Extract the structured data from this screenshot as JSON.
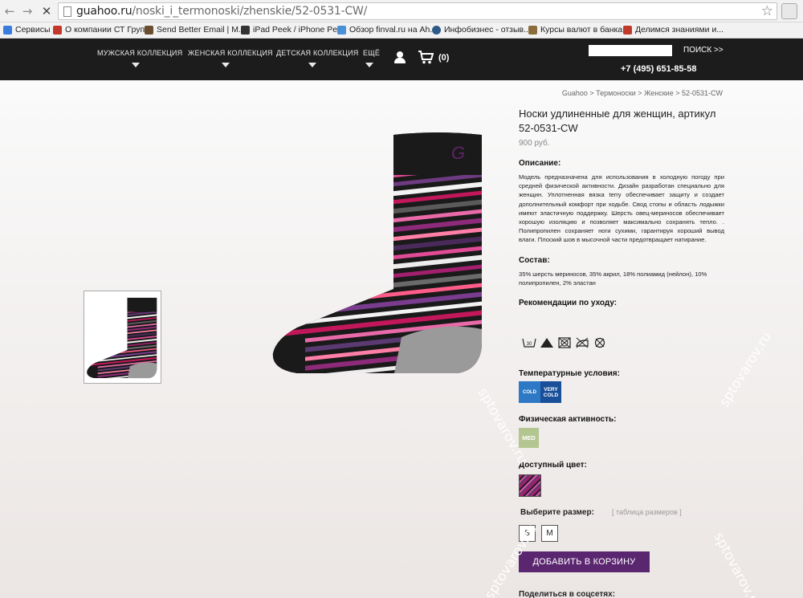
{
  "browser": {
    "url_host": "guahoo.ru",
    "url_path": "/noski_i_termonoski/zhenskie/52-0531-CW/"
  },
  "bookmarks": [
    {
      "label": "Сервисы",
      "color": "#3b7ddd"
    },
    {
      "label": "О компании СТ Групп",
      "color": "#c0392b"
    },
    {
      "label": "Send Better Email | M...",
      "color": "#6b4e2e"
    },
    {
      "label": "iPad Peek / iPhone Pe...",
      "color": "#333333"
    },
    {
      "label": "Обзор finval.ru на Ah...",
      "color": "#4a90d9"
    },
    {
      "label": "Инфобизнес - отзыв...",
      "color": "#2e5a88"
    },
    {
      "label": "Курсы валют в банка...",
      "color": "#8a6d3b"
    },
    {
      "label": "Делимся знаниями и...",
      "color": "#c0392b"
    }
  ],
  "nav": {
    "men": "МУЖСКАЯ КОЛЛЕКЦИЯ",
    "women": "ЖЕНСКАЯ КОЛЛЕКЦИЯ",
    "kids": "ДЕТСКАЯ КОЛЛЕКЦИЯ",
    "more": "ЕЩЁ",
    "cart_count": "(0)",
    "search": "ПОИСК >>",
    "phone": "+7 (495) 651-85-58"
  },
  "breadcrumb": "Guahoo > Термоноски > Женские > 52-0531-CW",
  "product": {
    "title": "Носки удлиненные для женщин, артикул 52-0531-CW",
    "price": "900 руб.",
    "description_heading": "Описание:",
    "description": "Модель предназначена для использования в холодную погоду при средней физической активности. Дизайн разработан специально для женщин. Уплотненная вязка terry обеспечивает защиту и создает дополнительный комфорт при ходьбе. Свод стопы и область лодыжки имеют эластичную поддержку. Шерсть овец-мериносов обеспечивает хорошую изоляцию и позволяет максимально сохранять тепло. . Полипропилен сохраняет ноги сухими, гарантируя хороший вывод влаги. Плоский шов в мысочной части предотвращает натирание.",
    "composition_heading": "Состав:",
    "composition": "35% шерсть мериносов, 35% акрил, 18% полиамид (нейлон), 10% полипропилен, 2% эластан",
    "care_heading": "Рекомендации по уходу:",
    "care_wash_temp": "30",
    "temp_heading": "Температурные условия:",
    "temp_badge_cold": "COLD",
    "temp_badge_vcold": "VERY COLD",
    "activity_heading": "Физическая активность:",
    "activity_badge": "MED",
    "color_heading": "Доступный цвет:",
    "size_heading": "Выберите размер:",
    "size_table": "[ таблица размеров ]",
    "sizes": [
      "S",
      "M"
    ],
    "add_to_cart": "ДОБАВИТЬ В КОРЗИНУ",
    "share_heading": "Поделиться в соцсетях:"
  },
  "watermark": "sptovarov.ru",
  "colors": {
    "header_bg": "#1c1c1c",
    "cart_button": "#5b2670",
    "sock_black": "#1a1a1a",
    "sock_magenta": "#a3206e"
  }
}
